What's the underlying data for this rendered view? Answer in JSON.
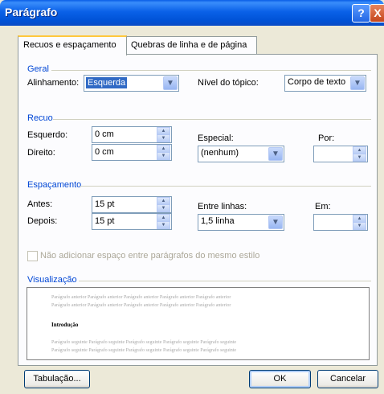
{
  "window": {
    "title": "Parágrafo",
    "help_label": "?",
    "close_label": "X"
  },
  "tabs": [
    {
      "label": "Recuos e espaçamento",
      "mnemonic_index": 0,
      "active": true
    },
    {
      "label": "Quebras de linha e de página",
      "mnemonic_index": 0,
      "active": false
    }
  ],
  "geral": {
    "heading": "Geral",
    "alinhamento_label": "Alinhamento:",
    "alinhamento_value": "Esquerda",
    "nivel_label": "Nível do tópico:",
    "nivel_value": "Corpo de texto"
  },
  "recuo": {
    "heading": "Recuo",
    "esquerdo_label": "Esquerdo:",
    "esquerdo_value": "0 cm",
    "direito_label": "Direito:",
    "direito_value": "0 cm",
    "especial_label": "Especial:",
    "especial_value": "(nenhum)",
    "por_label": "Por:",
    "por_value": ""
  },
  "espacamento": {
    "heading": "Espaçamento",
    "antes_label": "Antes:",
    "antes_value": "15 pt",
    "depois_label": "Depois:",
    "depois_value": "15 pt",
    "entre_linhas_label": "Entre linhas:",
    "entre_linhas_value": "1,5 linha",
    "em_label": "Em:",
    "em_value": "",
    "nao_adicionar_label": "Não adicionar espaço entre parágrafos do mesmo estilo",
    "nao_adicionar_checked": false
  },
  "visualizacao": {
    "heading": "Visualização",
    "prev_text": "Parágrafo anterior Parágrafo anterior Parágrafo anterior Parágrafo anterior Parágrafo anterior",
    "sample_text": "Introdução",
    "next_text": "Parágrafo seguinte Parágrafo seguinte Parágrafo seguinte Parágrafo seguinte Parágrafo seguinte"
  },
  "buttons": {
    "tabulacao": "Tabulação...",
    "ok": "OK",
    "cancelar": "Cancelar"
  },
  "icons": {
    "dropdown": "chevron-down-icon",
    "spin_up": "arrow-up-icon",
    "spin_down": "arrow-down-icon"
  }
}
